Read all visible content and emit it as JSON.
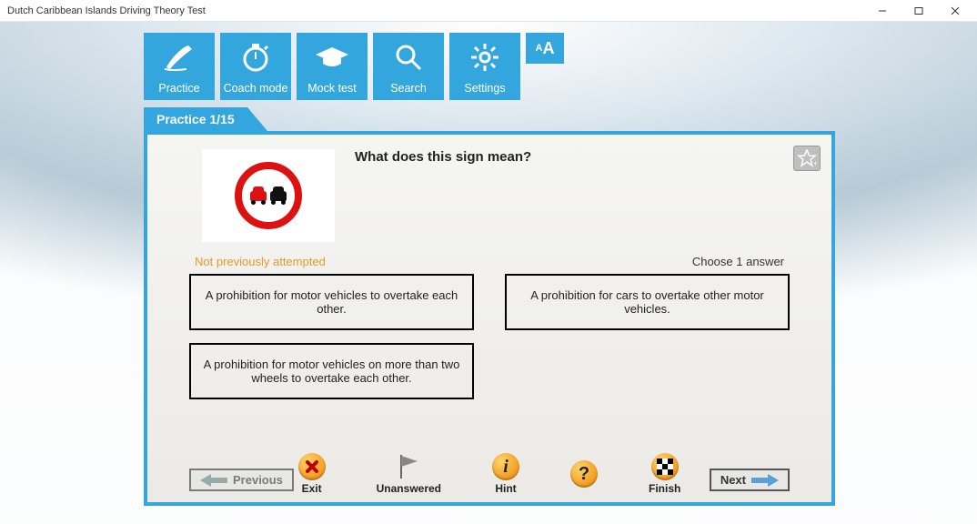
{
  "window": {
    "title": "Dutch Caribbean Islands Driving Theory Test"
  },
  "toolbar": {
    "practice": "Practice",
    "coach": "Coach mode",
    "mock": "Mock test",
    "search": "Search",
    "settings": "Settings",
    "textsize": "AA"
  },
  "tab": {
    "label": "Practice 1/15"
  },
  "question": {
    "text": "What does this sign mean?",
    "status": "Not previously attempted",
    "choose": "Choose 1 answer",
    "answers": [
      "A prohibition for motor vehicles to overtake each other.",
      "A prohibition for cars to overtake other motor vehicles.",
      "A prohibition for motor vehicles on more than two wheels to overtake each other."
    ]
  },
  "footer": {
    "previous": "Previous",
    "exit": "Exit",
    "unanswered": "Unanswered",
    "hint": "Hint",
    "finish": "Finish",
    "next": "Next"
  }
}
